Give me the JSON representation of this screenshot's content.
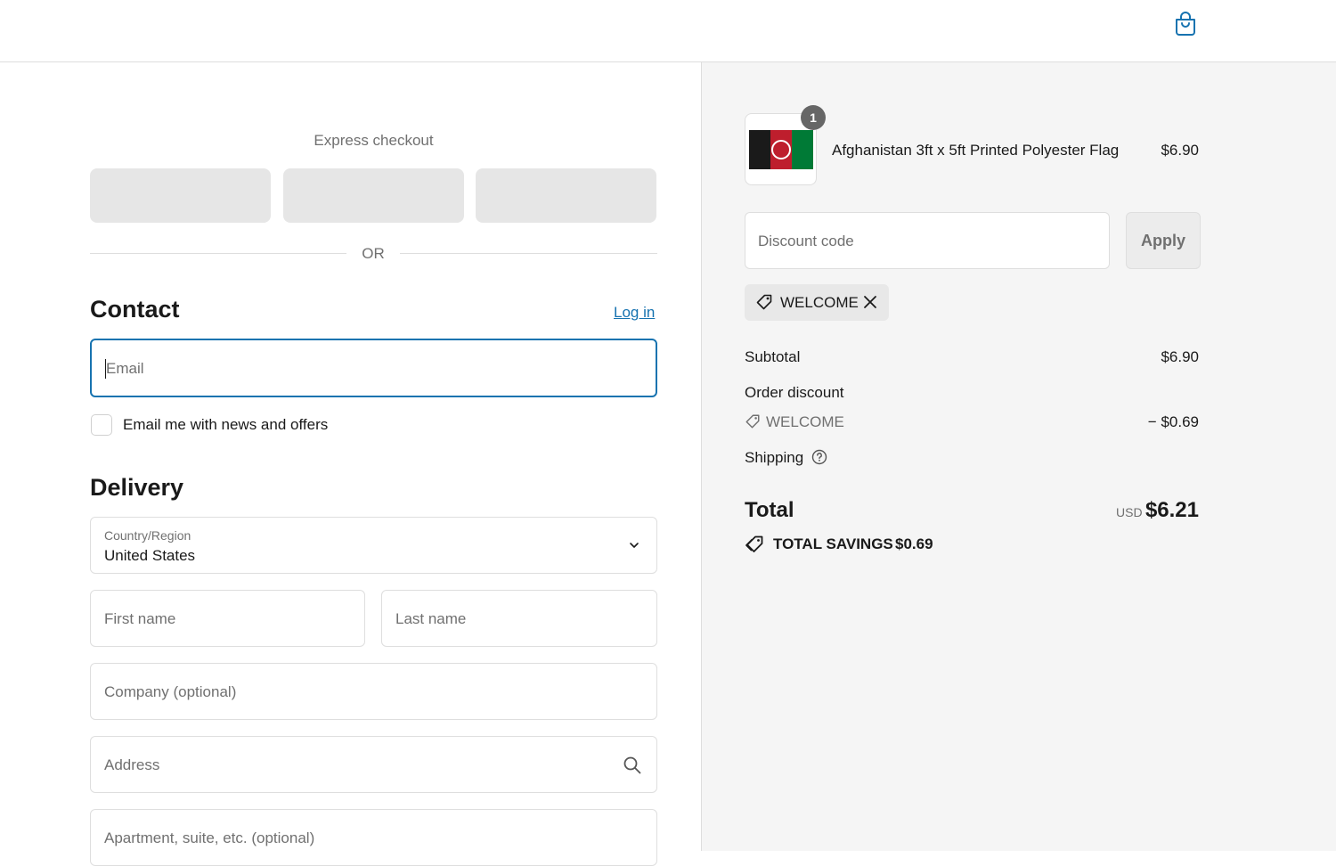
{
  "express": {
    "title": "Express checkout",
    "or_label": "OR"
  },
  "contact": {
    "title": "Contact",
    "login_label": "Log in",
    "email_placeholder": "Email",
    "newsletter_label": "Email me with news and offers",
    "newsletter_checked": false
  },
  "delivery": {
    "title": "Delivery",
    "country_label": "Country/Region",
    "country_value": "United States",
    "first_name_placeholder": "First name",
    "last_name_placeholder": "Last name",
    "company_placeholder": "Company (optional)",
    "address_placeholder": "Address",
    "apartment_placeholder": "Apartment, suite, etc. (optional)"
  },
  "cart": {
    "quantity": "1",
    "product_name": "Afghanistan 3ft x 5ft Printed Polyester Flag",
    "product_price": "$6.90"
  },
  "discount": {
    "placeholder": "Discount code",
    "apply_label": "Apply",
    "applied_code": "WELCOME"
  },
  "summary": {
    "subtotal_label": "Subtotal",
    "subtotal_value": "$6.90",
    "order_discount_label": "Order discount",
    "discount_code": "WELCOME",
    "discount_value": "− $0.69",
    "shipping_label": "Shipping",
    "total_label": "Total",
    "currency": "USD",
    "total_value": "$6.21",
    "savings_label": "TOTAL SAVINGS",
    "savings_value": "$0.69"
  },
  "colors": {
    "accent": "#1773b0",
    "panel_bg": "#f5f5f5",
    "muted_text": "#707070"
  },
  "icons": [
    "shopping-bag-icon",
    "chevron-down-icon",
    "search-icon",
    "tag-icon",
    "close-icon",
    "help-icon",
    "savings-tag-icon"
  ]
}
